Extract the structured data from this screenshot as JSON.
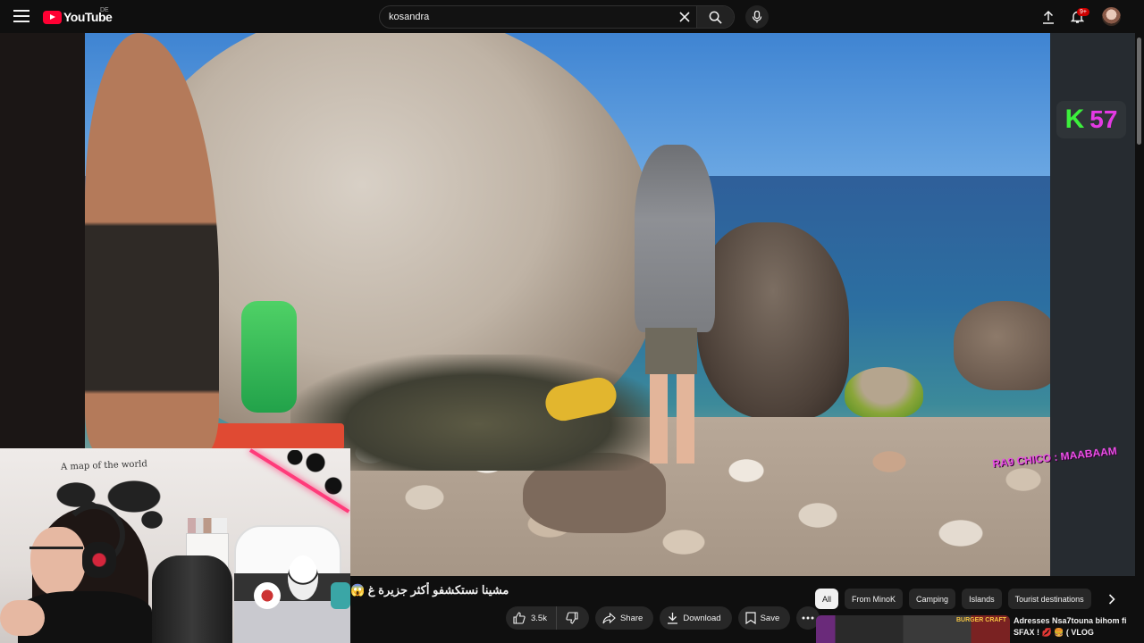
{
  "masthead": {
    "logo_text": "YouTube",
    "region": "DE",
    "search": {
      "value": "kosandra",
      "placeholder": "Search"
    },
    "notifications_badge": "9+",
    "icons": {
      "menu": "hamburger-menu-icon",
      "clear": "close-icon",
      "search": "search-icon",
      "mic": "microphone-icon",
      "upload": "upload-icon",
      "notifications": "bell-icon"
    }
  },
  "video": {
    "overlay_logo": {
      "k": "K",
      "num": "57"
    },
    "overlay_caption": "RA9 CHICO : MAABAAM"
  },
  "webcam": {
    "map_title": "A map of the world"
  },
  "below_video": {
    "title": "مشينا نستكشفو أكثر جزيرة غ 😱",
    "actions": {
      "like_count": "3.5k",
      "share": "Share",
      "download": "Download",
      "save": "Save"
    }
  },
  "sidebar": {
    "chips": [
      "All",
      "From MinoK",
      "Camping",
      "Islands",
      "Tourist destinations"
    ],
    "active_chip": "All",
    "recommendation": {
      "title": "Adresses Nsa7touna bihom fi SFAX ! 💋 🍔 ( VLOG",
      "thumb_label": "BURGER CRAFT"
    }
  },
  "colors": {
    "background": "#0f0f0f",
    "accent_red": "#ff0033",
    "chip_bg": "#272727",
    "overlay_green": "#3cf03c",
    "overlay_magenta": "#e43ae4"
  }
}
